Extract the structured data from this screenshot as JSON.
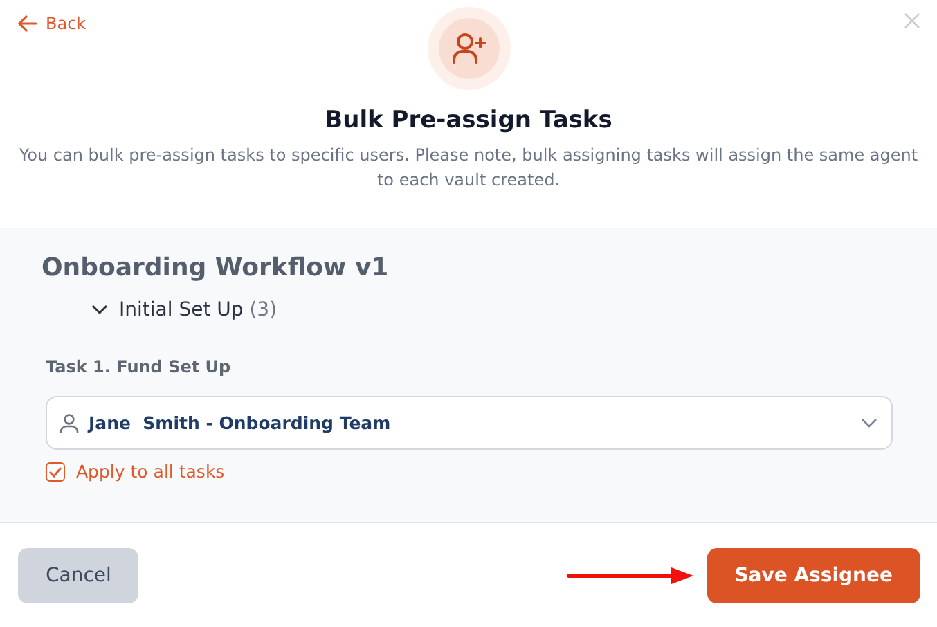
{
  "back_link": "Back",
  "dialog": {
    "title": "Bulk Pre-assign Tasks",
    "description": "You can bulk pre-assign tasks to specific users. Please note, bulk assigning tasks will assign the same agent to each vault created."
  },
  "workflow": {
    "title": "Onboarding Workflow v1",
    "group": {
      "label": "Initial Set Up",
      "count": "(3)",
      "expanded": true
    },
    "task": {
      "label": "Task 1. Fund Set Up",
      "assignee": "Jane  Smith - Onboarding Team"
    },
    "apply_all": {
      "label": "Apply to all tasks",
      "checked": true
    }
  },
  "buttons": [
    {
      "label": "Cancel",
      "kind": "secondary"
    },
    {
      "label": "Save Assignee",
      "kind": "primary"
    }
  ]
}
